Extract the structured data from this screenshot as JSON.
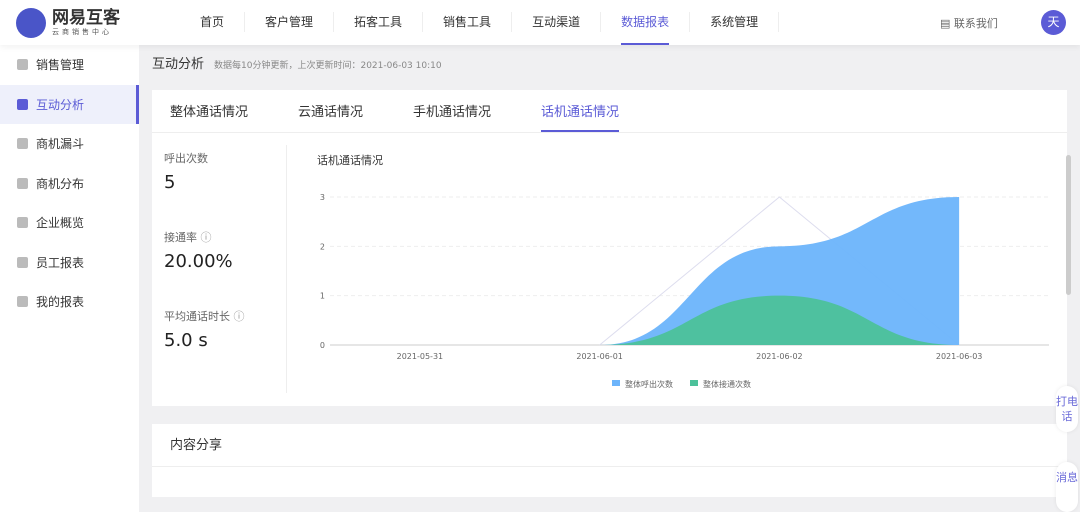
{
  "logo": {
    "title": "网易互客",
    "subtitle": "云商销售中心"
  },
  "nav": [
    "首页",
    "客户管理",
    "拓客工具",
    "销售工具",
    "互动渠道",
    "数据报表",
    "系统管理"
  ],
  "nav_active": 5,
  "header": {
    "contact": "联系我们",
    "avatar": "天"
  },
  "sidebar": [
    "销售管理",
    "互动分析",
    "商机漏斗",
    "商机分布",
    "企业概览",
    "员工报表",
    "我的报表"
  ],
  "page": {
    "title": "互动分析",
    "note": "数据每10分钟更新，上次更新时间：2021-06-03 10:10"
  },
  "tabs": [
    "整体通话情况",
    "云通话情况",
    "手机通话情况",
    "话机通话情况"
  ],
  "stats": [
    {
      "label": "呼出次数",
      "value": "5"
    },
    {
      "label": "接通率",
      "value": "20.00%"
    },
    {
      "label": "平均通话时长",
      "value": "5.0 s"
    }
  ],
  "chart_data": {
    "type": "area",
    "title": "话机通话情况",
    "categories": [
      "2021-05-31",
      "2021-06-01",
      "2021-06-02",
      "2021-06-03"
    ],
    "ylim": [
      0,
      3
    ],
    "yticks": [
      "0",
      "1",
      "2",
      "3"
    ],
    "series": [
      {
        "name": "整体呼出次数",
        "color": "#6cb4fb",
        "values": [
          0,
          0,
          2,
          3
        ]
      },
      {
        "name": "整体接通次数",
        "color": "#4cc19a",
        "values": [
          0,
          0,
          1,
          0
        ]
      }
    ],
    "legend": "bottom"
  },
  "section2": {
    "title": "内容分享"
  },
  "float": {
    "call": "打电话",
    "msg": "消息"
  }
}
